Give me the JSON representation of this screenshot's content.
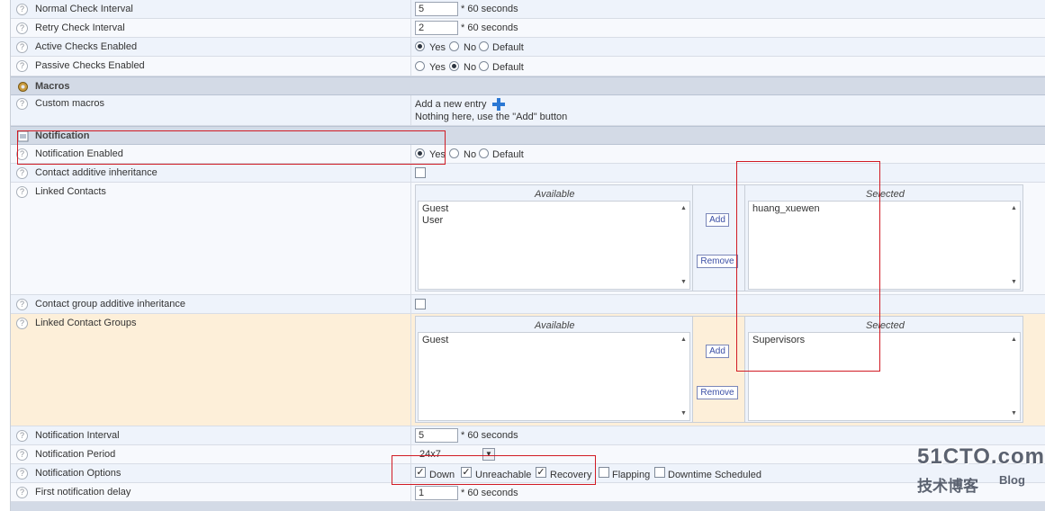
{
  "rows": {
    "normal_check": {
      "label": "Normal Check Interval",
      "value": "5",
      "unit": "* 60 seconds"
    },
    "retry_check": {
      "label": "Retry Check Interval",
      "value": "2",
      "unit": "* 60 seconds"
    },
    "active_checks": {
      "label": "Active Checks Enabled",
      "options": [
        "Yes",
        "No",
        "Default"
      ],
      "selected": "Yes"
    },
    "passive_checks": {
      "label": "Passive Checks Enabled",
      "options": [
        "Yes",
        "No",
        "Default"
      ],
      "selected": "No"
    },
    "custom_macros": {
      "label": "Custom macros",
      "add_text": "Add a new entry",
      "empty_text": "Nothing here, use the \"Add\" button"
    },
    "notification_enabled": {
      "label": "Notification Enabled",
      "options": [
        "Yes",
        "No",
        "Default"
      ],
      "selected": "Yes"
    },
    "contact_additive": {
      "label": "Contact additive inheritance"
    },
    "linked_contacts": {
      "label": "Linked Contacts",
      "available_header": "Available",
      "selected_header": "Selected",
      "available": [
        "Guest",
        "User"
      ],
      "selected": [
        "huang_xuewen"
      ],
      "add_label": "Add",
      "remove_label": "Remove"
    },
    "contact_group_additive": {
      "label": "Contact group additive inheritance"
    },
    "linked_contact_groups": {
      "label": "Linked Contact Groups",
      "available_header": "Available",
      "selected_header": "Selected",
      "available": [
        "Guest"
      ],
      "selected": [
        "Supervisors"
      ],
      "add_label": "Add",
      "remove_label": "Remove"
    },
    "notification_interval": {
      "label": "Notification Interval",
      "value": "5",
      "unit": "* 60 seconds"
    },
    "notification_period": {
      "label": "Notification Period",
      "value": "24x7"
    },
    "notification_options": {
      "label": "Notification Options",
      "options": [
        {
          "label": "Down",
          "checked": true
        },
        {
          "label": "Unreachable",
          "checked": true
        },
        {
          "label": "Recovery",
          "checked": true
        },
        {
          "label": "Flapping",
          "checked": false
        },
        {
          "label": "Downtime Scheduled",
          "checked": false
        }
      ]
    },
    "first_notification_delay": {
      "label": "First notification delay",
      "value": "1",
      "unit": "* 60 seconds"
    }
  },
  "sections": {
    "macros": "Macros",
    "notification": "Notification"
  },
  "help_glyph": "?",
  "watermark": {
    "logo": "51CTO.com",
    "sub": "技术博客",
    "blog": "Blog"
  },
  "colors": {
    "annotation_red": "#d11b24",
    "section_bg": "#d3dae6",
    "peach_row": "#fdefd9",
    "link_blue": "#3a4ea5"
  }
}
